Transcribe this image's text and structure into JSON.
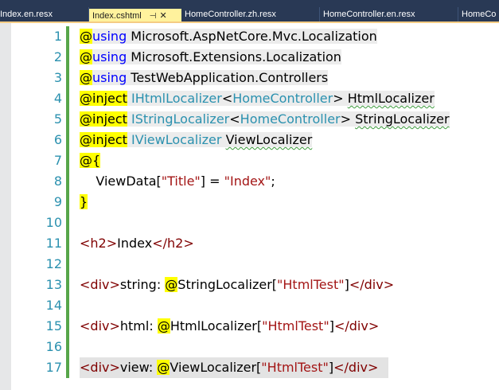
{
  "tabs": [
    {
      "label": "Index.en.resx",
      "active": false
    },
    {
      "label": "Index.cshtml",
      "active": true,
      "pin_icon": "pin-icon",
      "close_icon": "close-icon"
    },
    {
      "label": "HomeController.zh.resx",
      "active": false
    },
    {
      "label": "HomeController.en.resx",
      "active": false
    },
    {
      "label": "HomeCo",
      "active": false
    }
  ],
  "editor": {
    "line_numbers": [
      "1",
      "2",
      "3",
      "4",
      "5",
      "6",
      "7",
      "8",
      "9",
      "10",
      "11",
      "12",
      "13",
      "14",
      "15",
      "16",
      "17"
    ],
    "lines": [
      [
        {
          "t": "at",
          "v": "@"
        },
        {
          "t": "kw",
          "v": "using"
        },
        {
          "t": "plain",
          "v": " Microsoft.AspNetCore.Mvc.Localization"
        }
      ],
      [
        {
          "t": "at",
          "v": "@"
        },
        {
          "t": "kw",
          "v": "using"
        },
        {
          "t": "plain",
          "v": " Microsoft.Extensions.Localization"
        }
      ],
      [
        {
          "t": "at",
          "v": "@"
        },
        {
          "t": "kw",
          "v": "using"
        },
        {
          "t": "plain",
          "v": " TestWebApplication.Controllers"
        }
      ],
      [
        {
          "t": "at",
          "v": "@inject"
        },
        {
          "t": "plain",
          "v": " "
        },
        {
          "t": "type",
          "v": "IHtmlLocalizer"
        },
        {
          "t": "plain",
          "v": "<"
        },
        {
          "t": "type",
          "v": "HomeController"
        },
        {
          "t": "plain",
          "v": "> "
        },
        {
          "t": "squig",
          "v": "HtmlLocalizer"
        }
      ],
      [
        {
          "t": "at",
          "v": "@inject"
        },
        {
          "t": "plain",
          "v": " "
        },
        {
          "t": "type",
          "v": "IStringLocalizer"
        },
        {
          "t": "plain",
          "v": "<"
        },
        {
          "t": "type",
          "v": "HomeController"
        },
        {
          "t": "plain",
          "v": "> "
        },
        {
          "t": "squig",
          "v": "StringLocalizer"
        }
      ],
      [
        {
          "t": "at",
          "v": "@inject"
        },
        {
          "t": "plain",
          "v": " "
        },
        {
          "t": "type",
          "v": "IViewLocalizer"
        },
        {
          "t": "plain",
          "v": " "
        },
        {
          "t": "squig",
          "v": "ViewLocalizer"
        }
      ],
      [
        {
          "t": "at",
          "v": "@{"
        }
      ],
      [
        {
          "t": "plain",
          "v": "    ViewData["
        },
        {
          "t": "str",
          "v": "\"Title\""
        },
        {
          "t": "plain",
          "v": "] = "
        },
        {
          "t": "str",
          "v": "\"Index\""
        },
        {
          "t": "plain",
          "v": ";"
        }
      ],
      [
        {
          "t": "at",
          "v": "}"
        }
      ],
      [],
      [
        {
          "t": "tag",
          "v": "<"
        },
        {
          "t": "tag",
          "v": "h2"
        },
        {
          "t": "tag",
          "v": ">"
        },
        {
          "t": "plain",
          "v": "Index"
        },
        {
          "t": "tag",
          "v": "</"
        },
        {
          "t": "tag",
          "v": "h2"
        },
        {
          "t": "tag",
          "v": ">"
        }
      ],
      [],
      [
        {
          "t": "tag",
          "v": "<"
        },
        {
          "t": "tag",
          "v": "div"
        },
        {
          "t": "tag",
          "v": ">"
        },
        {
          "t": "plain",
          "v": "string: "
        },
        {
          "t": "at",
          "v": "@"
        },
        {
          "t": "plain",
          "v": "StringLocalizer["
        },
        {
          "t": "str",
          "v": "\"HtmlTest\""
        },
        {
          "t": "plain",
          "v": "]"
        },
        {
          "t": "tag",
          "v": "</"
        },
        {
          "t": "tag",
          "v": "div"
        },
        {
          "t": "tag",
          "v": ">"
        }
      ],
      [],
      [
        {
          "t": "tag",
          "v": "<"
        },
        {
          "t": "tag",
          "v": "div"
        },
        {
          "t": "tag",
          "v": ">"
        },
        {
          "t": "plain",
          "v": "html: "
        },
        {
          "t": "at",
          "v": "@"
        },
        {
          "t": "plain",
          "v": "HtmlLocalizer["
        },
        {
          "t": "str",
          "v": "\"HtmlTest\""
        },
        {
          "t": "plain",
          "v": "]"
        },
        {
          "t": "tag",
          "v": "</"
        },
        {
          "t": "tag",
          "v": "div"
        },
        {
          "t": "tag",
          "v": ">"
        }
      ],
      [],
      [
        {
          "t": "tag",
          "v": "<"
        },
        {
          "t": "tag",
          "v": "div"
        },
        {
          "t": "tag",
          "v": ">"
        },
        {
          "t": "plain",
          "v": "view: "
        },
        {
          "t": "at",
          "v": "@"
        },
        {
          "t": "plain",
          "v": "ViewLocalizer["
        },
        {
          "t": "str",
          "v": "\"HtmlTest\""
        },
        {
          "t": "plain",
          "v": "]"
        },
        {
          "t": "tag",
          "v": "</"
        },
        {
          "t": "tag",
          "v": "div"
        },
        {
          "t": "tag",
          "v": ">"
        }
      ]
    ]
  },
  "colors": {
    "tabbar_bg": "#293955",
    "active_tab_bg": "#fff29d",
    "line_number": "#2b91af",
    "razor_highlight": "#ffff00",
    "keyword": "#0000ff",
    "type": "#2b91af",
    "string": "#a31515",
    "html_tag": "#800000",
    "change_bar": "#57a64a"
  }
}
